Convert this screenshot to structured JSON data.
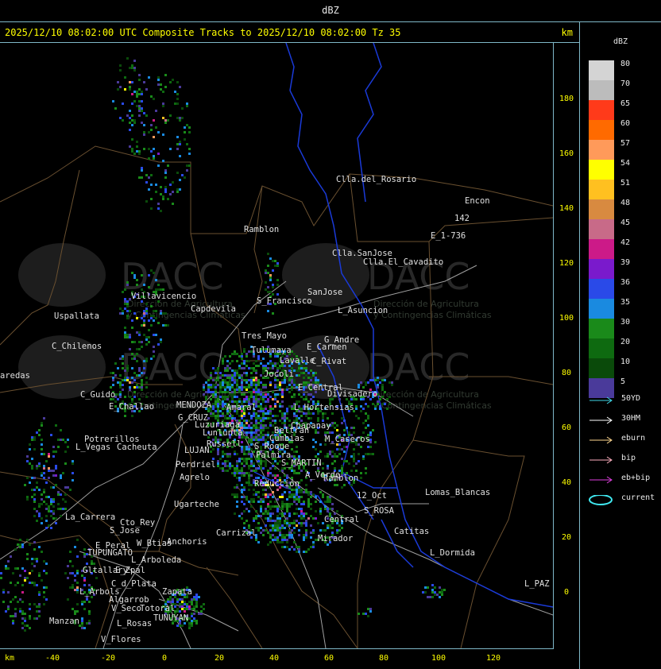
{
  "header": {
    "unit_label": "dBZ"
  },
  "title": {
    "text": "2025/12/10 08:02:00 UTC Composite Tracks to 2025/12/10 08:02:00 Tz 35",
    "km_label": "km"
  },
  "map": {
    "places": [
      "Clla.del_Rosario",
      "Encon",
      "142",
      "E_1-736",
      "Ramblon",
      "Clla.SanJose",
      "Clla.El_Cavadito",
      "Villavicencio",
      "Capdevila",
      "S_Francisco",
      "SanJose",
      "L_Asuncion",
      "Uspallata",
      "C_Chilenos",
      "Tres_Mayo",
      "Tulumaya",
      "E_Carmen",
      "G_Andre",
      "Lavalle",
      "C_Rivat",
      "aredas",
      "C_Guido",
      "E_Challao",
      "MENDOZA",
      "Jocoli",
      "E_Central",
      "Divisadero",
      "L_Hortensias",
      "G_CRUZ",
      "Luzuriaga",
      "Beltran",
      "Chapanay",
      "Cumbias",
      "M_Caseros",
      "Potrerillos",
      "L_Vegas",
      "Cacheuta",
      "Lunlunta",
      "Russell",
      "LUJAN",
      "S_Roque",
      "Palmira",
      "Perdriel",
      "S_MARTIN",
      "A_Verde",
      "Agrelo",
      "Reducción",
      "Ramblon",
      "Ugarteche",
      "12_Oct",
      "S_ROSA",
      "Lomas_Blancas",
      "La_Carrera",
      "Cto_Rey",
      "S_Jose",
      "Carrizal",
      "Central",
      "Catitas",
      "Mirador",
      "W_Btias",
      "Anchoris",
      "E_Peral",
      "TUPUNGATO",
      "L_Arboleda",
      "L_Dormida",
      "Gltallary",
      "E_Zpal",
      "C_d_Plata",
      "L_Arbols",
      "Zapata",
      "Algarrob",
      "Manzan",
      "V_Seco",
      "Totoral",
      "L_Rosas",
      "TUNUYAN",
      "V_Flores",
      "L_PAZ",
      "Amaral"
    ],
    "watermark": {
      "brand": "DACC",
      "line1": "Dirección de Agricultura",
      "line2": "y Contingencias Climáticas"
    }
  },
  "axes": {
    "y_unit": "km",
    "y_ticks": [
      "180",
      "160",
      "140",
      "120",
      "100",
      "80",
      "60",
      "40",
      "20",
      "0"
    ],
    "x_unit": "km",
    "x_ticks": [
      "-40",
      "-20",
      "0",
      "20",
      "40",
      "60",
      "80",
      "100",
      "120"
    ]
  },
  "legend": {
    "title": "dBZ",
    "scale": [
      {
        "label": "80",
        "color": "#d4d4d4"
      },
      {
        "label": "70",
        "color": "#bcbcbc"
      },
      {
        "label": "65",
        "color": "#ff3a1a"
      },
      {
        "label": "60",
        "color": "#ff6a00"
      },
      {
        "label": "57",
        "color": "#ff9a5a"
      },
      {
        "label": "54",
        "color": "#ffff00"
      },
      {
        "label": "51",
        "color": "#ffc020"
      },
      {
        "label": "48",
        "color": "#d88a40"
      },
      {
        "label": "45",
        "color": "#c86a88"
      },
      {
        "label": "42",
        "color": "#cc1a88"
      },
      {
        "label": "39",
        "color": "#7a1acc"
      },
      {
        "label": "36",
        "color": "#2a4ae8"
      },
      {
        "label": "35",
        "color": "#1a8ae0"
      },
      {
        "label": "30",
        "color": "#1a8a1a"
      },
      {
        "label": "20",
        "color": "#0e6a10"
      },
      {
        "label": "10",
        "color": "#0a4a0a"
      },
      {
        "label": "5",
        "color": "#4a3a9a"
      }
    ],
    "tracks": [
      {
        "label": "50YD",
        "color": "#40d8e8",
        "kind": "arrow"
      },
      {
        "label": "30HM",
        "color": "#ffffff",
        "kind": "arrow"
      },
      {
        "label": "eburn",
        "color": "#ffd890",
        "kind": "arrow"
      },
      {
        "label": "bip",
        "color": "#ffb0c0",
        "kind": "arrow"
      },
      {
        "label": "eb+bip",
        "color": "#e040e0",
        "kind": "arrow"
      },
      {
        "label": "current",
        "color": "#40e8f0",
        "kind": "ellipse"
      }
    ]
  }
}
